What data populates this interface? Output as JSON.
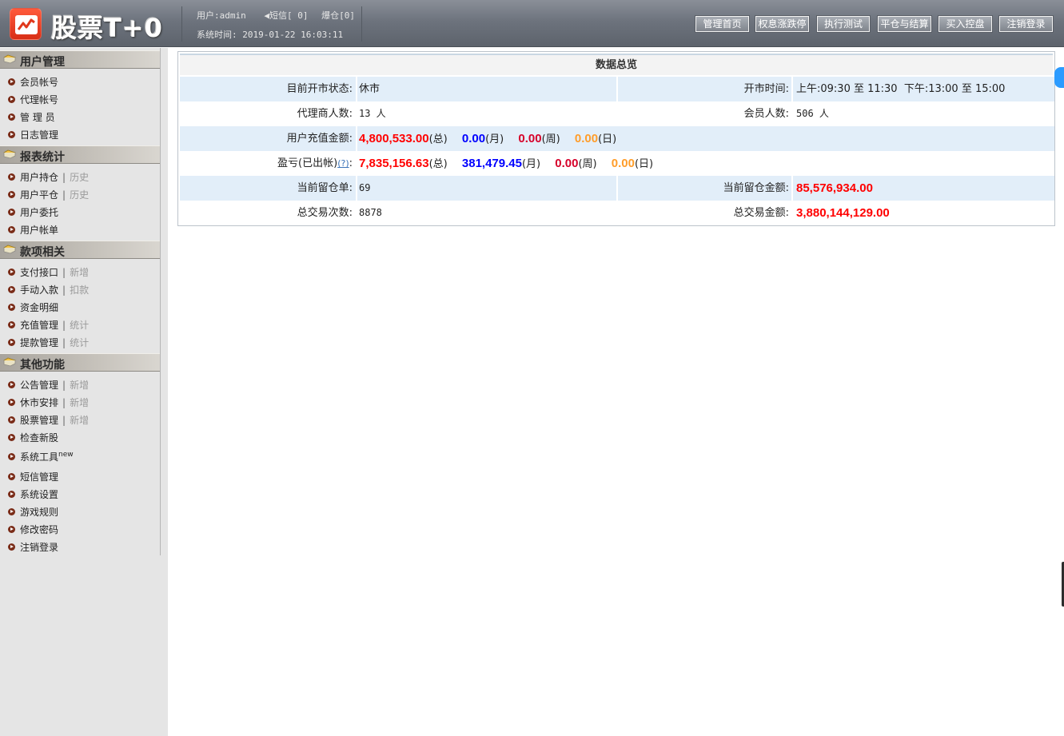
{
  "header": {
    "brand": "股票T+0",
    "user_label": "用户:admin",
    "sms": "短信[ 0]",
    "blowup": "爆仓[0]",
    "system_time": "系统时间: 2019-01-22 16:03:11",
    "nav": [
      "管理首页",
      "权息涨跌停",
      "执行测试",
      "平仓与结算",
      "买入控盘",
      "注销登录"
    ]
  },
  "sidebar": {
    "sections": [
      {
        "title": "用户管理",
        "items": [
          {
            "label": "会员帐号"
          },
          {
            "label": "代理帐号"
          },
          {
            "label": "管 理 员"
          },
          {
            "label": "日志管理"
          }
        ]
      },
      {
        "title": "报表统计",
        "items": [
          {
            "label": "用户持仓",
            "sub": "历史"
          },
          {
            "label": "用户平仓",
            "sub": "历史"
          },
          {
            "label": "用户委托"
          },
          {
            "label": "用户帐单"
          }
        ]
      },
      {
        "title": "款项相关",
        "items": [
          {
            "label": "支付接口",
            "sub": "新增"
          },
          {
            "label": "手动入款",
            "sub": "扣款"
          },
          {
            "label": "资金明细"
          },
          {
            "label": "充值管理",
            "sub": "统计"
          },
          {
            "label": "提款管理",
            "sub": "统计"
          }
        ]
      },
      {
        "title": "其他功能",
        "items": [
          {
            "label": "公告管理",
            "sub": "新增"
          },
          {
            "label": "休市安排",
            "sub": "新增"
          },
          {
            "label": "股票管理",
            "sub": "新增"
          },
          {
            "label": "检查新股"
          },
          {
            "label": "系统工具",
            "sup": "new"
          },
          {
            "label": "短信管理"
          },
          {
            "label": "系统设置"
          },
          {
            "label": "游戏规则"
          },
          {
            "label": "修改密码"
          },
          {
            "label": "注销登录"
          }
        ]
      }
    ]
  },
  "overview": {
    "title": "数据总览",
    "market_status_label": "目前开市状态:",
    "market_status": "休市",
    "open_time_label": "开市时间:",
    "open_time": "上午:09:30 至 11:30  下午:13:00 至 15:00",
    "agents_label": "代理商人数:",
    "agents": "13 人",
    "members_label": "会员人数:",
    "members": "506 人",
    "recharge_label": "用户充值金额:",
    "recharge_total": "4,800,533.00",
    "recharge_month": "0.00",
    "recharge_week": "0.00",
    "recharge_day": "0.00",
    "pnl_label": "盈亏(已出帐)",
    "pnl_help": "(?)",
    "pnl_total": "7,835,156.63",
    "pnl_month": "381,479.45",
    "pnl_week": "0.00",
    "pnl_day": "0.00",
    "u_total": "(总)",
    "u_month": "(月)",
    "u_week": "(周)",
    "u_day": "(日)",
    "open_orders_label": "当前留仓单:",
    "open_orders": "69",
    "open_amount_label": "当前留仓金额:",
    "open_amount": "85,576,934.00",
    "trades_label": "总交易次数:",
    "trades": "8878",
    "trade_amount_label": "总交易金额:",
    "trade_amount": "3,880,144,129.00"
  },
  "colors": {
    "red": "#ff0000",
    "blue": "#0000ff",
    "crimson": "#d6002a",
    "orange": "#ff9d2a",
    "row_alt": "#e2eef9"
  }
}
